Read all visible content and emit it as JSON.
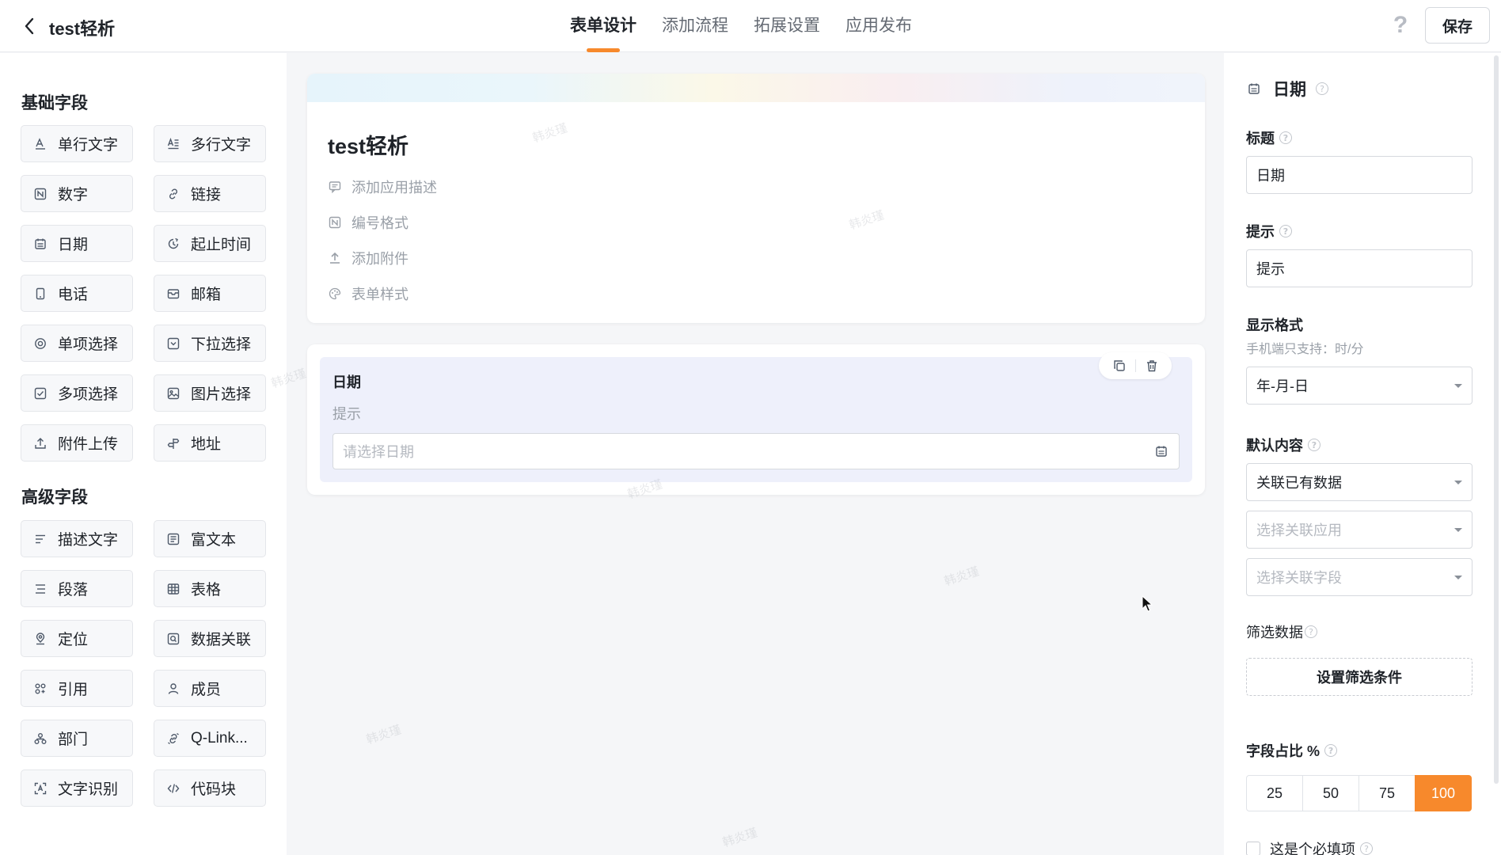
{
  "header": {
    "app_title": "test轻析",
    "tabs": [
      {
        "label": "表单设计",
        "active": true
      },
      {
        "label": "添加流程",
        "active": false
      },
      {
        "label": "拓展设置",
        "active": false
      },
      {
        "label": "应用发布",
        "active": false
      }
    ],
    "help_label": "?",
    "save_label": "保存"
  },
  "left_panel": {
    "basic_title": "基础字段",
    "basic_fields": [
      {
        "label": "单行文字",
        "icon": "text-icon"
      },
      {
        "label": "多行文字",
        "icon": "multiline-text-icon"
      },
      {
        "label": "数字",
        "icon": "number-icon"
      },
      {
        "label": "链接",
        "icon": "link-icon"
      },
      {
        "label": "日期",
        "icon": "calendar-icon"
      },
      {
        "label": "起止时间",
        "icon": "time-range-icon"
      },
      {
        "label": "电话",
        "icon": "phone-icon"
      },
      {
        "label": "邮箱",
        "icon": "mail-icon"
      },
      {
        "label": "单项选择",
        "icon": "radio-icon"
      },
      {
        "label": "下拉选择",
        "icon": "dropdown-icon"
      },
      {
        "label": "多项选择",
        "icon": "checkbox-icon"
      },
      {
        "label": "图片选择",
        "icon": "image-icon"
      },
      {
        "label": "附件上传",
        "icon": "upload-icon"
      },
      {
        "label": "地址",
        "icon": "address-icon"
      }
    ],
    "advanced_title": "高级字段",
    "advanced_fields": [
      {
        "label": "描述文字",
        "icon": "description-icon"
      },
      {
        "label": "富文本",
        "icon": "rich-text-icon"
      },
      {
        "label": "段落",
        "icon": "paragraph-icon"
      },
      {
        "label": "表格",
        "icon": "table-icon"
      },
      {
        "label": "定位",
        "icon": "location-icon"
      },
      {
        "label": "数据关联",
        "icon": "data-link-icon"
      },
      {
        "label": "引用",
        "icon": "reference-icon"
      },
      {
        "label": "成员",
        "icon": "member-icon"
      },
      {
        "label": "部门",
        "icon": "department-icon"
      },
      {
        "label": "Q-Link...",
        "icon": "qlink-icon"
      },
      {
        "label": "文字识别",
        "icon": "ocr-icon"
      },
      {
        "label": "代码块",
        "icon": "code-icon"
      }
    ]
  },
  "canvas": {
    "form_title": "test轻析",
    "form_options": [
      {
        "label": "添加应用描述",
        "icon": "comment-icon"
      },
      {
        "label": "编号格式",
        "icon": "number-format-icon"
      },
      {
        "label": "添加附件",
        "icon": "upload-icon"
      },
      {
        "label": "表单样式",
        "icon": "palette-icon"
      }
    ],
    "field_card": {
      "label": "日期",
      "hint": "提示",
      "placeholder": "请选择日期"
    },
    "watermark_text": "韩炎瑾"
  },
  "right_panel": {
    "field_type": "日期",
    "title_label": "标题",
    "title_value": "日期",
    "hint_label": "提示",
    "hint_value": "提示",
    "format_label": "显示格式",
    "format_sub": "手机端只支持：时/分",
    "format_value": "年-月-日",
    "default_label": "默认内容",
    "default_value": "关联已有数据",
    "app_placeholder": "选择关联应用",
    "field_placeholder": "选择关联字段",
    "filter_label": "筛选数据",
    "filter_button": "设置筛选条件",
    "ratio_label": "字段占比 %",
    "ratio_options": [
      "25",
      "50",
      "75",
      "100"
    ],
    "ratio_selected": "100",
    "required_label": "这是个必填项"
  },
  "colors": {
    "accent": "#f7892c",
    "field_card_bg": "#eef0fb"
  }
}
